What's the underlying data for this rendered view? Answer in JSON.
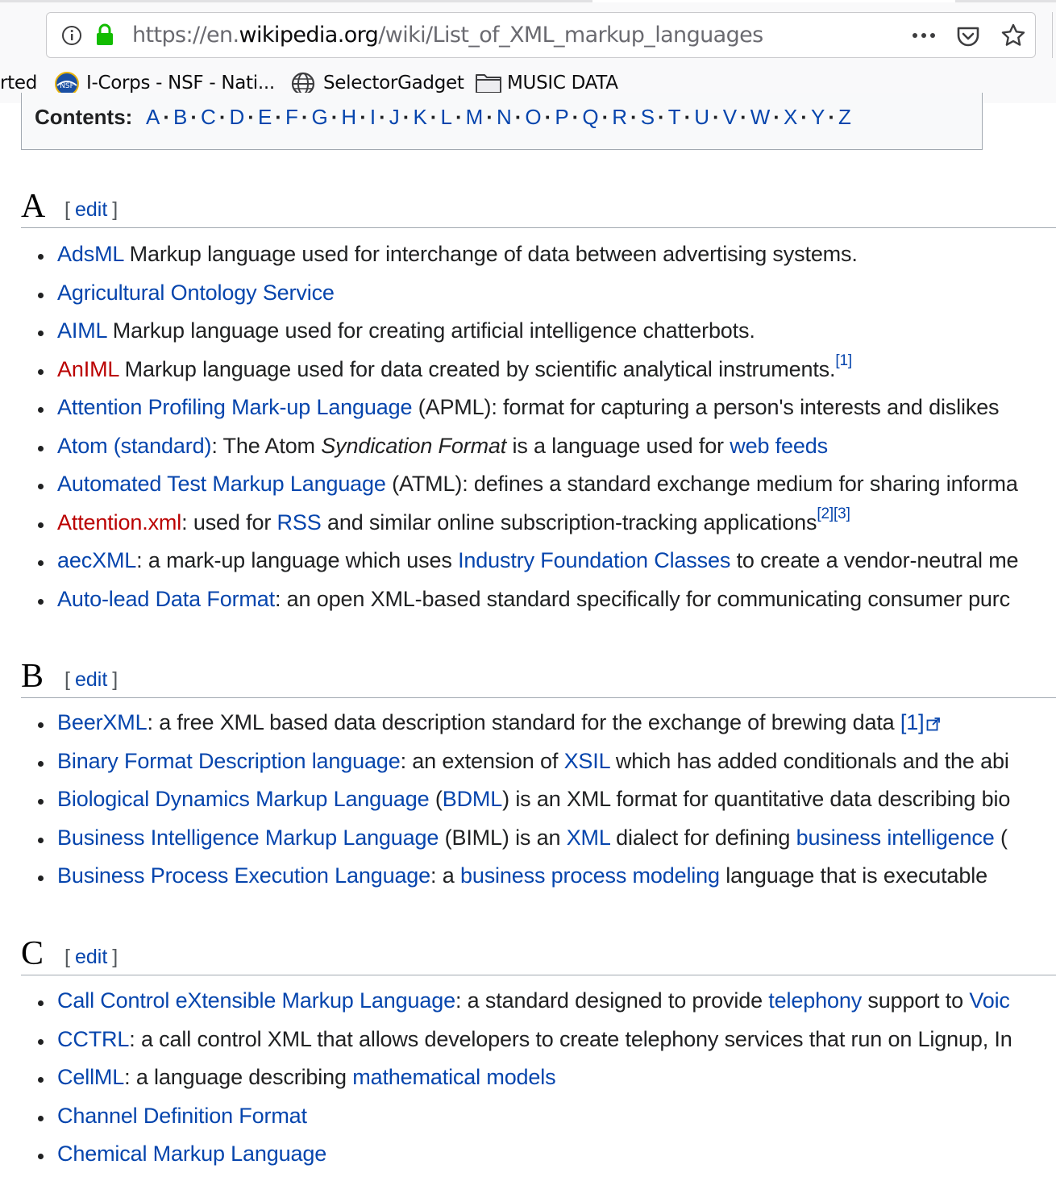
{
  "browser": {
    "url_scheme_host_prefix": "https://en.",
    "url_domain": "wikipedia.org",
    "url_path": "/wiki/List_of_XML_markup_languages",
    "bookmarks": [
      {
        "label": "rted"
      },
      {
        "label": "I-Corps - NSF - Nati..."
      },
      {
        "label": "SelectorGadget"
      },
      {
        "label": "MUSIC DATA"
      }
    ]
  },
  "toc": {
    "label": "Contents:",
    "letters": [
      "A",
      "B",
      "C",
      "D",
      "E",
      "F",
      "G",
      "H",
      "I",
      "J",
      "K",
      "L",
      "M",
      "N",
      "O",
      "P",
      "Q",
      "R",
      "S",
      "T",
      "U",
      "V",
      "W",
      "X",
      "Y",
      "Z"
    ]
  },
  "edit_label": "edit",
  "sections": {
    "A": {
      "heading": "A",
      "items": [
        {
          "parts": [
            {
              "t": "AdsML",
              "k": "blue"
            },
            {
              "t": " Markup language used for interchange of data between advertising systems."
            }
          ]
        },
        {
          "parts": [
            {
              "t": "Agricultural Ontology Service",
              "k": "blue"
            }
          ]
        },
        {
          "parts": [
            {
              "t": "AIML",
              "k": "blue"
            },
            {
              "t": " Markup language used for creating artificial intelligence chatterbots."
            }
          ]
        },
        {
          "parts": [
            {
              "t": "AnIML",
              "k": "red"
            },
            {
              "t": " Markup language used for data created by scientific analytical instruments."
            },
            {
              "t": "[1]",
              "k": "sup"
            }
          ]
        },
        {
          "parts": [
            {
              "t": "Attention Profiling Mark-up Language",
              "k": "blue"
            },
            {
              "t": " (APML): format for capturing a person's interests and dislikes"
            }
          ]
        },
        {
          "parts": [
            {
              "t": "Atom (standard)",
              "k": "blue"
            },
            {
              "t": ": The Atom "
            },
            {
              "t": "Syndication Format",
              "k": "italic"
            },
            {
              "t": " is a language used for "
            },
            {
              "t": "web feeds",
              "k": "blue"
            }
          ]
        },
        {
          "parts": [
            {
              "t": "Automated Test Markup Language",
              "k": "blue"
            },
            {
              "t": " (ATML): defines a standard exchange medium for sharing informa"
            }
          ]
        },
        {
          "parts": [
            {
              "t": "Attention.xml",
              "k": "red"
            },
            {
              "t": ": used for "
            },
            {
              "t": "RSS",
              "k": "blue"
            },
            {
              "t": " and similar online subscription-tracking applications"
            },
            {
              "t": "[2]",
              "k": "sup"
            },
            {
              "t": "[3]",
              "k": "sup"
            }
          ]
        },
        {
          "parts": [
            {
              "t": "aecXML",
              "k": "blue"
            },
            {
              "t": ": a mark-up language which uses "
            },
            {
              "t": "Industry Foundation Classes",
              "k": "blue"
            },
            {
              "t": " to create a vendor-neutral me"
            }
          ]
        },
        {
          "parts": [
            {
              "t": "Auto-lead Data Format",
              "k": "blue"
            },
            {
              "t": ": an open XML-based standard specifically for communicating consumer purc"
            }
          ]
        }
      ]
    },
    "B": {
      "heading": "B",
      "items": [
        {
          "parts": [
            {
              "t": "BeerXML",
              "k": "blue"
            },
            {
              "t": ": a free XML based data description standard for the exchange of brewing data "
            },
            {
              "t": "[1]",
              "k": "ext"
            }
          ]
        },
        {
          "parts": [
            {
              "t": "Binary Format Description language",
              "k": "blue"
            },
            {
              "t": ": an extension of "
            },
            {
              "t": "XSIL",
              "k": "blue"
            },
            {
              "t": " which has added conditionals and the abi"
            }
          ]
        },
        {
          "parts": [
            {
              "t": "Biological Dynamics Markup Language",
              "k": "blue"
            },
            {
              "t": " ("
            },
            {
              "t": "BDML",
              "k": "blue"
            },
            {
              "t": ") is an XML format for quantitative data describing bio"
            }
          ]
        },
        {
          "parts": [
            {
              "t": "Business Intelligence Markup Language",
              "k": "blue"
            },
            {
              "t": " (BIML) is an "
            },
            {
              "t": "XML",
              "k": "blue"
            },
            {
              "t": " dialect for defining "
            },
            {
              "t": "business intelligence",
              "k": "blue"
            },
            {
              "t": " ("
            }
          ]
        },
        {
          "parts": [
            {
              "t": "Business Process Execution Language",
              "k": "blue"
            },
            {
              "t": ": a "
            },
            {
              "t": "business process modeling",
              "k": "blue"
            },
            {
              "t": " language that is executable"
            }
          ]
        }
      ]
    },
    "C": {
      "heading": "C",
      "items": [
        {
          "parts": [
            {
              "t": "Call Control eXtensible Markup Language",
              "k": "blue"
            },
            {
              "t": ": a standard designed to provide "
            },
            {
              "t": "telephony",
              "k": "blue"
            },
            {
              "t": " support to "
            },
            {
              "t": "Voic",
              "k": "blue"
            }
          ]
        },
        {
          "parts": [
            {
              "t": "CCTRL",
              "k": "blue"
            },
            {
              "t": ": a call control XML that allows developers to create telephony services that run on Lignup, In"
            }
          ]
        },
        {
          "parts": [
            {
              "t": "CellML",
              "k": "blue"
            },
            {
              "t": ": a language describing "
            },
            {
              "t": "mathematical models",
              "k": "blue"
            }
          ]
        },
        {
          "parts": [
            {
              "t": "Channel Definition Format",
              "k": "blue"
            }
          ]
        },
        {
          "parts": [
            {
              "t": "Chemical Markup Language",
              "k": "blue"
            }
          ]
        }
      ]
    }
  }
}
